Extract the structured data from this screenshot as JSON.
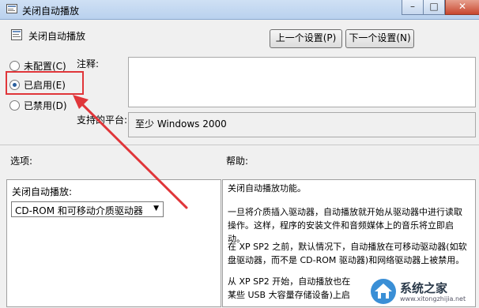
{
  "window": {
    "title": "关闭自动播放",
    "minimize": "–",
    "maximize": "□",
    "close": "✕"
  },
  "header": {
    "policy_title": "关闭自动播放",
    "prev_button": "上一个设置(P)",
    "next_button": "下一个设置(N)"
  },
  "state_options": [
    {
      "label": "未配置(C)",
      "checked": false
    },
    {
      "label": "已启用(E)",
      "checked": true
    },
    {
      "label": "已禁用(D)",
      "checked": false
    }
  ],
  "comment": {
    "label": "注释:",
    "value": ""
  },
  "platform": {
    "label": "支持的平台:",
    "value": "至少 Windows 2000"
  },
  "options": {
    "heading": "选项:",
    "field_label": "关闭自动播放:",
    "dropdown_value": "CD-ROM 和可移动介质驱动器"
  },
  "help": {
    "heading": "帮助:",
    "paragraphs": [
      "关闭自动播放功能。",
      "一旦将介质插入驱动器，自动播放就开始从驱动器中进行读取操作。这样，程序的安装文件和音频媒体上的音乐将立即启动。",
      "在 XP SP2 之前，默认情况下，自动播放在可移动驱动器(如软盘驱动器，而不是 CD-ROM 驱动器)和网络驱动器上被禁用。",
      "从 XP SP2 开始，自动播放也在",
      "某些 USB 大容量存储设备)上启"
    ]
  },
  "watermark": {
    "site_name": "系统之家",
    "url": "www.xitongzhijia.net"
  },
  "colors": {
    "highlight": "#e0363a",
    "title_bar": "#c6d7ee"
  }
}
